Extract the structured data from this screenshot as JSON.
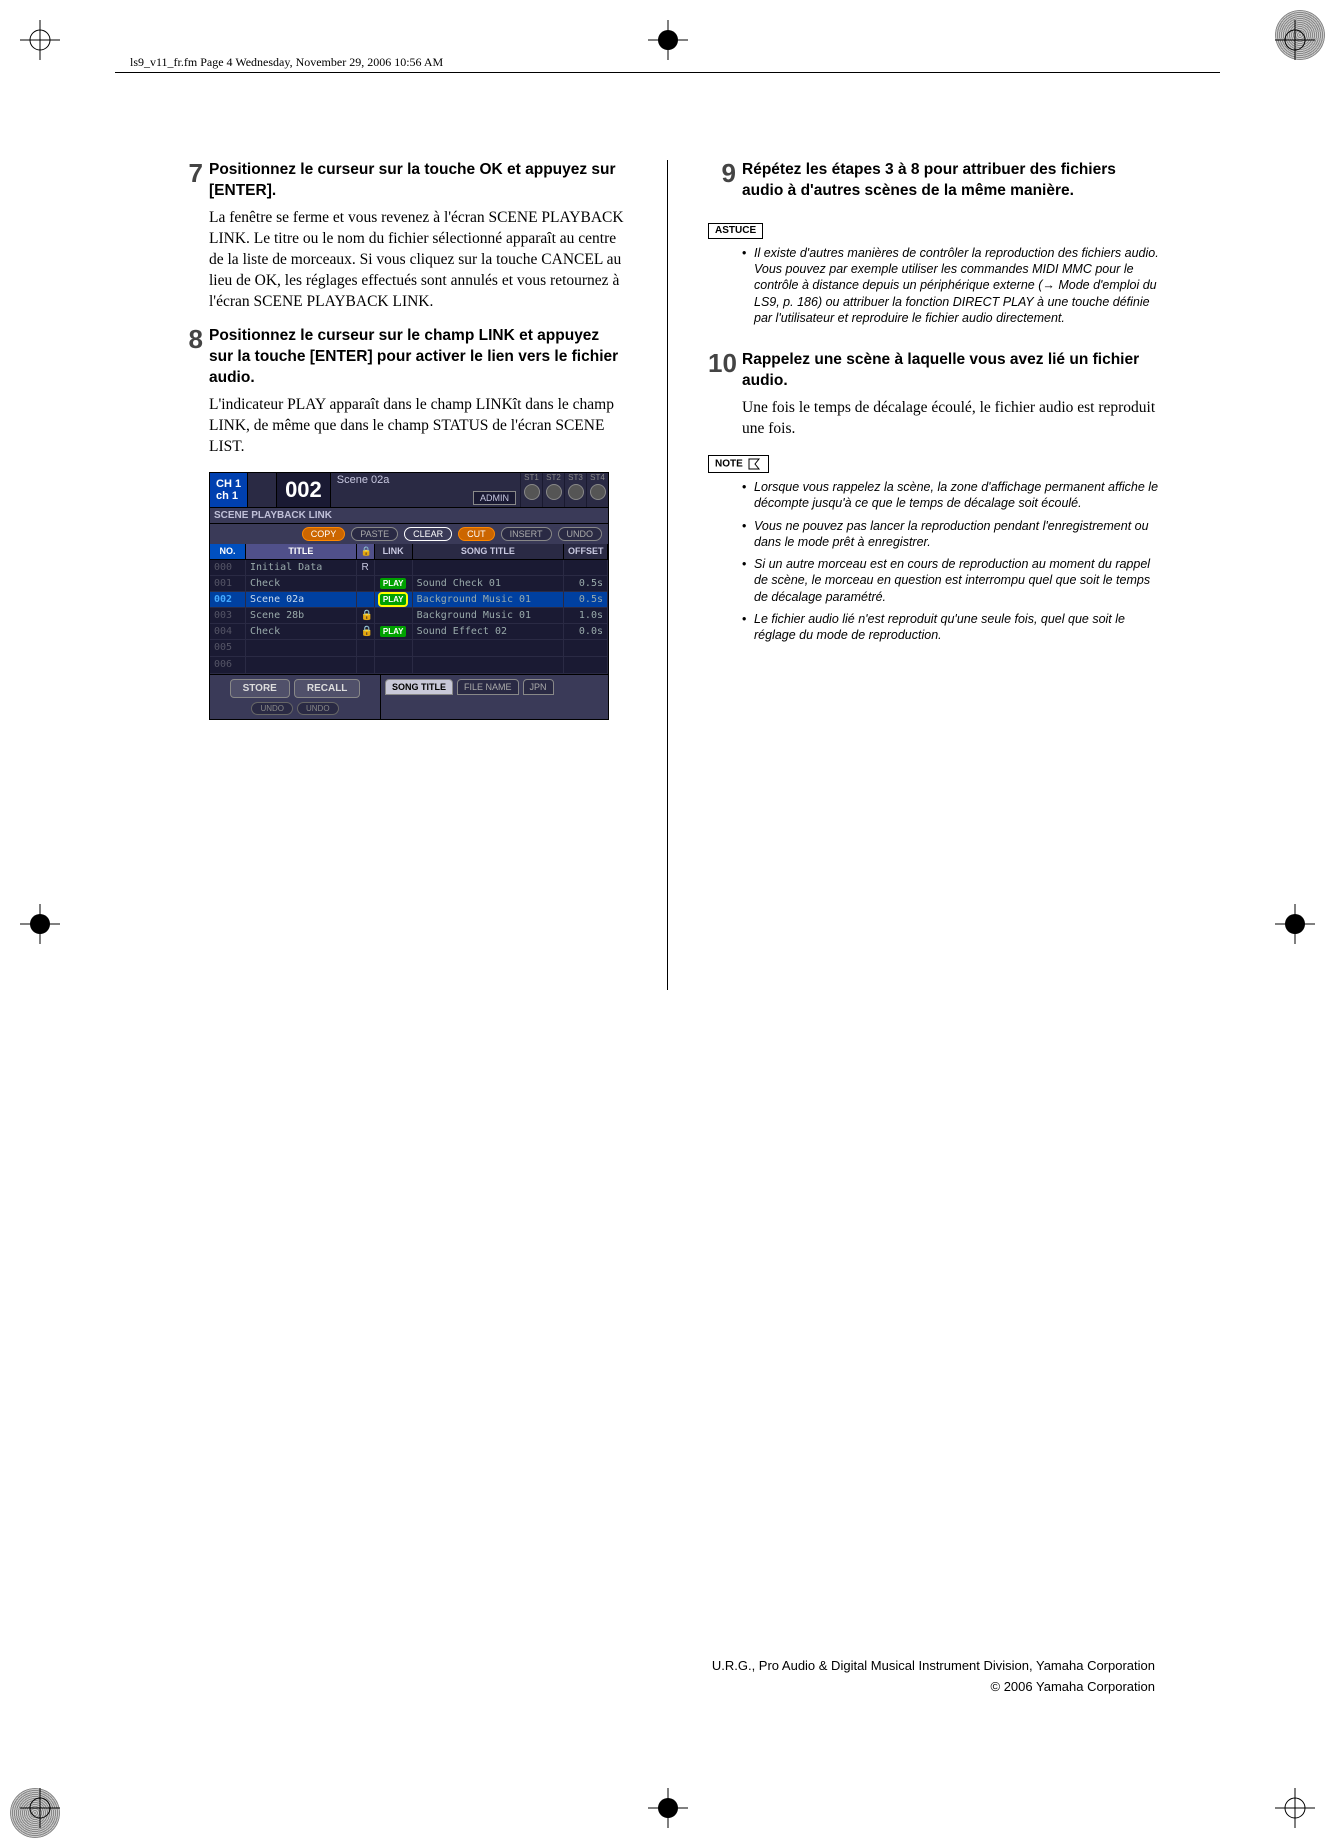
{
  "header_line": "ls9_v11_fr.fm  Page 4  Wednesday, November 29, 2006  10:56 AM",
  "left": {
    "step7": {
      "num": "7",
      "title": "Positionnez le curseur sur la touche OK et appuyez sur [ENTER].",
      "body": "La fenêtre se ferme et vous revenez à l'écran SCENE PLAYBACK LINK. Le titre ou le nom du fichier sélectionné apparaît au centre de la liste de morceaux. Si vous cliquez sur la touche CANCEL au lieu de OK, les réglages effectués sont annulés et vous retournez à l'écran SCENE PLAYBACK LINK."
    },
    "step8": {
      "num": "8",
      "title": "Positionnez le curseur sur le champ LINK et appuyez sur la touche [ENTER] pour activer le lien vers le fichier audio.",
      "body": "L'indicateur PLAY apparaît dans le champ LINKît dans le champ LINK, de même que dans le champ STATUS de l'écran SCENE LIST."
    }
  },
  "right": {
    "step9": {
      "num": "9",
      "title": "Répétez les étapes 3 à 8 pour attribuer des fichiers audio à d'autres scènes de la même manière."
    },
    "astuce_label": "ASTUCE",
    "astuce_items": [
      "Il existe d'autres manières de contrôler la reproduction des fichiers audio. Vous pouvez par exemple utiliser les commandes MIDI MMC pour le contrôle à distance depuis un périphérique externe (→ Mode d'emploi du LS9, p. 186) ou attribuer la fonction DIRECT PLAY à une touche définie par l'utilisateur et reproduire le fichier audio directement."
    ],
    "step10": {
      "num": "10",
      "title": "Rappelez une scène à laquelle vous avez lié un fichier audio.",
      "body": "Une fois le temps de décalage écoulé, le fichier audio est reproduit une fois."
    },
    "note_label": "NOTE",
    "note_items": [
      "Lorsque vous rappelez la scène, la zone d'affichage permanent affiche le décompte jusqu'à ce que le temps de décalage soit écoulé.",
      "Vous ne pouvez pas lancer la reproduction pendant l'enregistrement ou dans le mode prêt à enregistrer.",
      "Si un autre morceau est en cours de reproduction au moment du rappel de scène, le morceau en question est interrompu quel que soit le temps de décalage paramétré.",
      "Le fichier audio lié n'est reproduit qu'une seule fois, quel que soit le réglage du mode de reproduction."
    ]
  },
  "screenshot": {
    "ch_top": "CH 1",
    "ch_bot": "ch 1",
    "scene_num": "002",
    "scene_name": "Scene 02a",
    "admin": "ADMIN",
    "st_labels": [
      "ST1",
      "ST2",
      "ST3",
      "ST4"
    ],
    "section": "SCENE PLAYBACK LINK",
    "btns": {
      "copy": "COPY",
      "paste": "PASTE",
      "clear": "CLEAR",
      "cut": "CUT",
      "insert": "INSERT",
      "undo": "UNDO"
    },
    "hdr": {
      "no": "NO.",
      "title": "TITLE",
      "lock": "🔒",
      "link": "LINK",
      "song": "SONG TITLE",
      "offset": "OFFSET"
    },
    "rows": [
      {
        "no": "000",
        "title": "Initial Data",
        "lock": "R",
        "link": "",
        "song": "",
        "off": ""
      },
      {
        "no": "001",
        "title": "Check",
        "lock": "",
        "link": "PLAY",
        "song": "Sound Check 01",
        "off": "0.5s"
      },
      {
        "no": "002",
        "title": "Scene 02a",
        "lock": "",
        "link": "PLAY",
        "song": "Background Music 01",
        "off": "0.5s",
        "sel": true,
        "hl": true
      },
      {
        "no": "003",
        "title": "Scene 28b",
        "lock": "🔒",
        "link": "",
        "song": "Background Music 01",
        "off": "1.0s"
      },
      {
        "no": "004",
        "title": "Check",
        "lock": "🔒",
        "link": "PLAY",
        "song": "Sound Effect 02",
        "off": "0.0s"
      },
      {
        "no": "005",
        "title": "",
        "lock": "",
        "link": "",
        "song": "",
        "off": ""
      },
      {
        "no": "006",
        "title": "",
        "lock": "",
        "link": "",
        "song": "",
        "off": ""
      }
    ],
    "bottom": {
      "store": "STORE",
      "recall": "RECALL",
      "undo1": "UNDO",
      "undo2": "UNDO",
      "songtitle": "SONG TITLE",
      "filename": "FILE NAME",
      "jpn": "JPN"
    }
  },
  "footer": {
    "line1": "U.R.G., Pro Audio & Digital Musical Instrument Division, Yamaha Corporation",
    "line2": "© 2006 Yamaha Corporation"
  }
}
